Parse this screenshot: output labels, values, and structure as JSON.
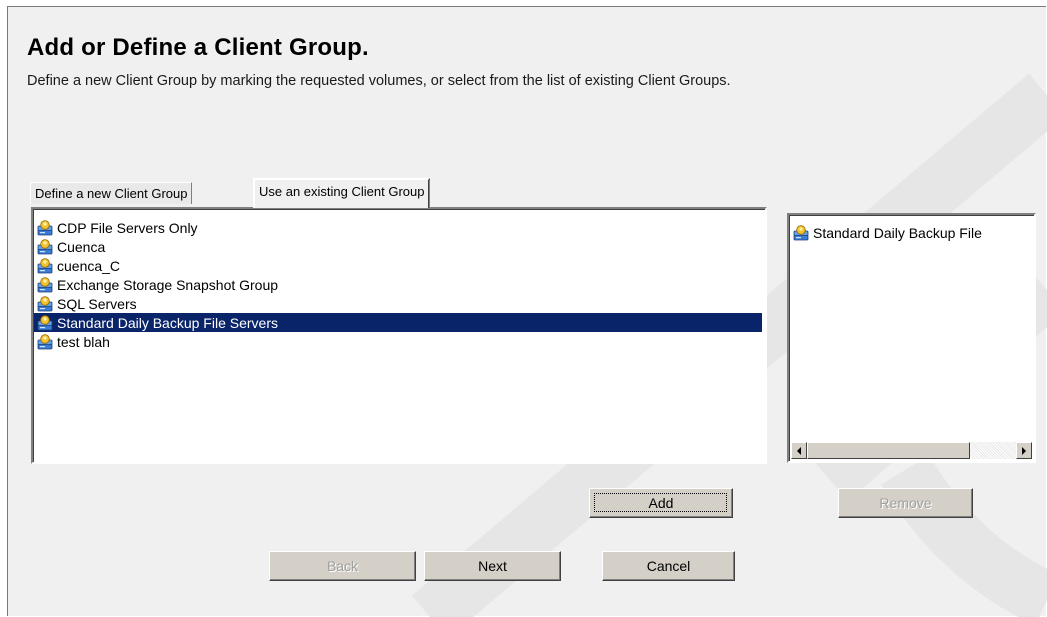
{
  "header": {
    "title": "Add or Define a Client Group.",
    "subtitle": "Define a new Client Group by marking the requested volumes, or select from the list of existing Client Groups."
  },
  "tabs": [
    {
      "label": "Define a new Client Group",
      "active": false
    },
    {
      "label": "Use an existing Client Group",
      "active": true
    }
  ],
  "client_groups": [
    {
      "label": "CDP File Servers Only",
      "icon": "client-group-icon"
    },
    {
      "label": "Cuenca",
      "icon": "client-group-icon"
    },
    {
      "label": "cuenca_C",
      "icon": "client-group-icon"
    },
    {
      "label": "Exchange Storage Snapshot Group",
      "icon": "client-group-icon"
    },
    {
      "label": "SQL  Servers",
      "icon": "client-group-icon"
    },
    {
      "label": "Standard Daily Backup File Servers",
      "icon": "client-group-icon",
      "selected": true
    },
    {
      "label": "test blah",
      "icon": "client-group-icon"
    }
  ],
  "selected_groups": [
    {
      "label": "Standard Daily Backup File",
      "icon": "client-group-icon"
    }
  ],
  "buttons": {
    "add": "Add",
    "remove": "Remove",
    "back": "Back",
    "next": "Next",
    "cancel": "Cancel"
  },
  "colors": {
    "selection": "#0a246a",
    "panel": "#f0f0f0",
    "button_face": "#d4d0c8",
    "disabled_text": "#a0a0a0"
  }
}
